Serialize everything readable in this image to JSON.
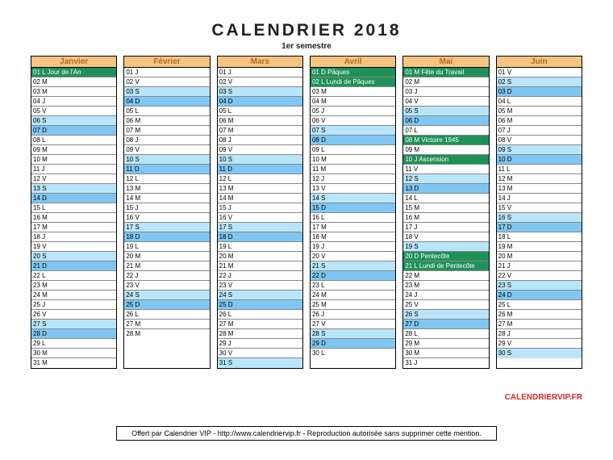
{
  "title": "CALENDRIER 2018",
  "subtitle": "1er semestre",
  "brand": "CALENDRIERVIP.FR",
  "footer": "Offert par Calendrier VIP - http://www.calendriervip.fr - Reproduction autorisée sans supprimer cette mention.",
  "months": [
    {
      "name": "Janvier",
      "days": [
        {
          "t": "01 L Jour de l'An",
          "c": "hol"
        },
        {
          "t": "02 M",
          "c": ""
        },
        {
          "t": "03 M",
          "c": ""
        },
        {
          "t": "04 J",
          "c": ""
        },
        {
          "t": "05 V",
          "c": ""
        },
        {
          "t": "06 S",
          "c": "sat"
        },
        {
          "t": "07 D",
          "c": "sun"
        },
        {
          "t": "08 L",
          "c": ""
        },
        {
          "t": "09 M",
          "c": ""
        },
        {
          "t": "10 M",
          "c": ""
        },
        {
          "t": "11 J",
          "c": ""
        },
        {
          "t": "12 V",
          "c": ""
        },
        {
          "t": "13 S",
          "c": "sat"
        },
        {
          "t": "14 D",
          "c": "sun"
        },
        {
          "t": "15 L",
          "c": ""
        },
        {
          "t": "16 M",
          "c": ""
        },
        {
          "t": "17 M",
          "c": ""
        },
        {
          "t": "18 J",
          "c": ""
        },
        {
          "t": "19 V",
          "c": ""
        },
        {
          "t": "20 S",
          "c": "sat"
        },
        {
          "t": "21 D",
          "c": "sun"
        },
        {
          "t": "22 L",
          "c": ""
        },
        {
          "t": "23 M",
          "c": ""
        },
        {
          "t": "24 M",
          "c": ""
        },
        {
          "t": "25 J",
          "c": ""
        },
        {
          "t": "26 V",
          "c": ""
        },
        {
          "t": "27 S",
          "c": "sat"
        },
        {
          "t": "28 D",
          "c": "sun"
        },
        {
          "t": "29 L",
          "c": ""
        },
        {
          "t": "30 M",
          "c": ""
        },
        {
          "t": "31 M",
          "c": ""
        }
      ]
    },
    {
      "name": "Février",
      "days": [
        {
          "t": "01 J",
          "c": ""
        },
        {
          "t": "02 V",
          "c": ""
        },
        {
          "t": "03 S",
          "c": "sat"
        },
        {
          "t": "04 D",
          "c": "sun"
        },
        {
          "t": "05 L",
          "c": ""
        },
        {
          "t": "06 M",
          "c": ""
        },
        {
          "t": "07 M",
          "c": ""
        },
        {
          "t": "08 J",
          "c": ""
        },
        {
          "t": "09 V",
          "c": ""
        },
        {
          "t": "10 S",
          "c": "sat"
        },
        {
          "t": "11 D",
          "c": "sun"
        },
        {
          "t": "12 L",
          "c": ""
        },
        {
          "t": "13 M",
          "c": ""
        },
        {
          "t": "14 M",
          "c": ""
        },
        {
          "t": "15 J",
          "c": ""
        },
        {
          "t": "16 V",
          "c": ""
        },
        {
          "t": "17 S",
          "c": "sat"
        },
        {
          "t": "18 D",
          "c": "sun"
        },
        {
          "t": "19 L",
          "c": ""
        },
        {
          "t": "20 M",
          "c": ""
        },
        {
          "t": "21 M",
          "c": ""
        },
        {
          "t": "22 J",
          "c": ""
        },
        {
          "t": "23 V",
          "c": ""
        },
        {
          "t": "24 S",
          "c": "sat"
        },
        {
          "t": "25 D",
          "c": "sun"
        },
        {
          "t": "26 L",
          "c": ""
        },
        {
          "t": "27 M",
          "c": ""
        },
        {
          "t": "28 M",
          "c": ""
        }
      ]
    },
    {
      "name": "Mars",
      "days": [
        {
          "t": "01 J",
          "c": ""
        },
        {
          "t": "02 V",
          "c": ""
        },
        {
          "t": "03 S",
          "c": "sat"
        },
        {
          "t": "04 D",
          "c": "sun"
        },
        {
          "t": "05 L",
          "c": ""
        },
        {
          "t": "06 M",
          "c": ""
        },
        {
          "t": "07 M",
          "c": ""
        },
        {
          "t": "08 J",
          "c": ""
        },
        {
          "t": "09 V",
          "c": ""
        },
        {
          "t": "10 S",
          "c": "sat"
        },
        {
          "t": "11 D",
          "c": "sun"
        },
        {
          "t": "12 L",
          "c": ""
        },
        {
          "t": "13 M",
          "c": ""
        },
        {
          "t": "14 M",
          "c": ""
        },
        {
          "t": "15 J",
          "c": ""
        },
        {
          "t": "16 V",
          "c": ""
        },
        {
          "t": "17 S",
          "c": "sat"
        },
        {
          "t": "18 D",
          "c": "sun"
        },
        {
          "t": "19 L",
          "c": ""
        },
        {
          "t": "20 M",
          "c": ""
        },
        {
          "t": "21 M",
          "c": ""
        },
        {
          "t": "22 J",
          "c": ""
        },
        {
          "t": "23 V",
          "c": ""
        },
        {
          "t": "24 S",
          "c": "sat"
        },
        {
          "t": "25 D",
          "c": "sun"
        },
        {
          "t": "26 L",
          "c": ""
        },
        {
          "t": "27 M",
          "c": ""
        },
        {
          "t": "28 M",
          "c": ""
        },
        {
          "t": "29 J",
          "c": ""
        },
        {
          "t": "30 V",
          "c": ""
        },
        {
          "t": "31 S",
          "c": "sat"
        }
      ]
    },
    {
      "name": "Avril",
      "days": [
        {
          "t": "01 D Pâques",
          "c": "hol"
        },
        {
          "t": "02 L Lundi de Pâques",
          "c": "hol"
        },
        {
          "t": "03 M",
          "c": ""
        },
        {
          "t": "04 M",
          "c": ""
        },
        {
          "t": "05 J",
          "c": ""
        },
        {
          "t": "06 V",
          "c": ""
        },
        {
          "t": "07 S",
          "c": "sat"
        },
        {
          "t": "08 D",
          "c": "sun"
        },
        {
          "t": "09 L",
          "c": ""
        },
        {
          "t": "10 M",
          "c": ""
        },
        {
          "t": "11 M",
          "c": ""
        },
        {
          "t": "12 J",
          "c": ""
        },
        {
          "t": "13 V",
          "c": ""
        },
        {
          "t": "14 S",
          "c": "sat"
        },
        {
          "t": "15 D",
          "c": "sun"
        },
        {
          "t": "16 L",
          "c": ""
        },
        {
          "t": "17 M",
          "c": ""
        },
        {
          "t": "18 M",
          "c": ""
        },
        {
          "t": "19 J",
          "c": ""
        },
        {
          "t": "20 V",
          "c": ""
        },
        {
          "t": "21 S",
          "c": "sat"
        },
        {
          "t": "22 D",
          "c": "sun"
        },
        {
          "t": "23 L",
          "c": ""
        },
        {
          "t": "24 M",
          "c": ""
        },
        {
          "t": "25 M",
          "c": ""
        },
        {
          "t": "26 J",
          "c": ""
        },
        {
          "t": "27 V",
          "c": ""
        },
        {
          "t": "28 S",
          "c": "sat"
        },
        {
          "t": "29 D",
          "c": "sun"
        },
        {
          "t": "30 L",
          "c": ""
        }
      ]
    },
    {
      "name": "Mai",
      "days": [
        {
          "t": "01 M Fête du Travail",
          "c": "hol"
        },
        {
          "t": "02 M",
          "c": ""
        },
        {
          "t": "03 J",
          "c": ""
        },
        {
          "t": "04 V",
          "c": ""
        },
        {
          "t": "05 S",
          "c": "sat"
        },
        {
          "t": "06 D",
          "c": "sun"
        },
        {
          "t": "07 L",
          "c": ""
        },
        {
          "t": "08 M Victoire 1945",
          "c": "hol"
        },
        {
          "t": "09 M",
          "c": ""
        },
        {
          "t": "10 J Ascension",
          "c": "hol"
        },
        {
          "t": "11 V",
          "c": ""
        },
        {
          "t": "12 S",
          "c": "sat"
        },
        {
          "t": "13 D",
          "c": "sun"
        },
        {
          "t": "14 L",
          "c": ""
        },
        {
          "t": "15 M",
          "c": ""
        },
        {
          "t": "16 M",
          "c": ""
        },
        {
          "t": "17 J",
          "c": ""
        },
        {
          "t": "18 V",
          "c": ""
        },
        {
          "t": "19 S",
          "c": "sat"
        },
        {
          "t": "20 D Pentecôte",
          "c": "hol"
        },
        {
          "t": "21 L Lundi de Pentecôte",
          "c": "hol"
        },
        {
          "t": "22 M",
          "c": ""
        },
        {
          "t": "23 M",
          "c": ""
        },
        {
          "t": "24 J",
          "c": ""
        },
        {
          "t": "25 V",
          "c": ""
        },
        {
          "t": "26 S",
          "c": "sat"
        },
        {
          "t": "27 D",
          "c": "sun"
        },
        {
          "t": "28 L",
          "c": ""
        },
        {
          "t": "29 M",
          "c": ""
        },
        {
          "t": "30 M",
          "c": ""
        },
        {
          "t": "31 J",
          "c": ""
        }
      ]
    },
    {
      "name": "Juin",
      "days": [
        {
          "t": "01 V",
          "c": ""
        },
        {
          "t": "02 S",
          "c": "sat"
        },
        {
          "t": "03 D",
          "c": "sun"
        },
        {
          "t": "04 L",
          "c": ""
        },
        {
          "t": "05 M",
          "c": ""
        },
        {
          "t": "06 M",
          "c": ""
        },
        {
          "t": "07 J",
          "c": ""
        },
        {
          "t": "08 V",
          "c": ""
        },
        {
          "t": "09 S",
          "c": "sat"
        },
        {
          "t": "10 D",
          "c": "sun"
        },
        {
          "t": "11 L",
          "c": ""
        },
        {
          "t": "12 M",
          "c": ""
        },
        {
          "t": "13 M",
          "c": ""
        },
        {
          "t": "14 J",
          "c": ""
        },
        {
          "t": "15 V",
          "c": ""
        },
        {
          "t": "16 S",
          "c": "sat"
        },
        {
          "t": "17 D",
          "c": "sun"
        },
        {
          "t": "18 L",
          "c": ""
        },
        {
          "t": "19 M",
          "c": ""
        },
        {
          "t": "20 M",
          "c": ""
        },
        {
          "t": "21 J",
          "c": ""
        },
        {
          "t": "22 V",
          "c": ""
        },
        {
          "t": "23 S",
          "c": "sat"
        },
        {
          "t": "24 D",
          "c": "sun"
        },
        {
          "t": "25 L",
          "c": ""
        },
        {
          "t": "26 M",
          "c": ""
        },
        {
          "t": "27 M",
          "c": ""
        },
        {
          "t": "28 J",
          "c": ""
        },
        {
          "t": "29 V",
          "c": ""
        },
        {
          "t": "30 S",
          "c": "sat"
        }
      ]
    }
  ]
}
